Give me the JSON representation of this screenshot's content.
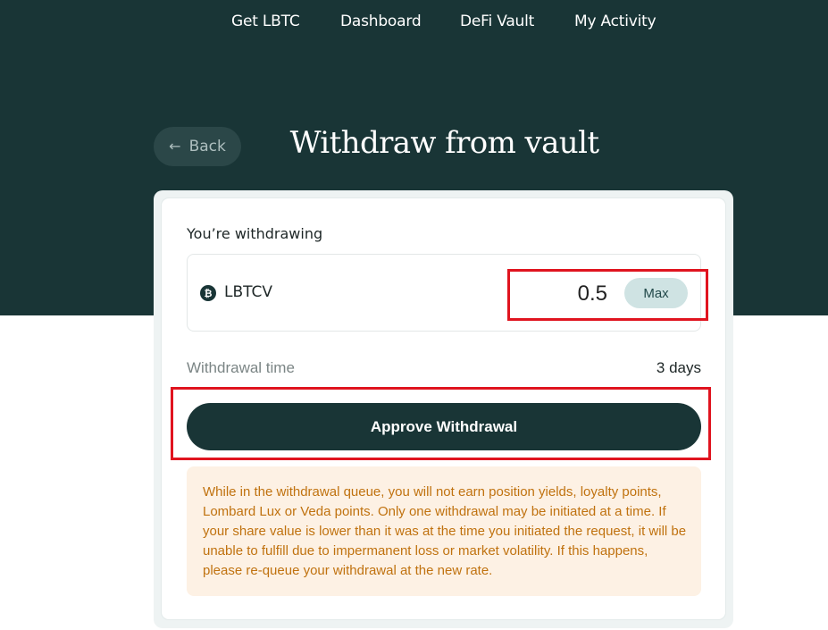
{
  "nav": {
    "items": [
      {
        "label": "Get LBTC"
      },
      {
        "label": "Dashboard"
      },
      {
        "label": "DeFi Vault"
      },
      {
        "label": "My Activity"
      }
    ]
  },
  "header": {
    "back_label": "Back",
    "title": "Withdraw from vault"
  },
  "form": {
    "withdrawing_label": "You’re withdrawing",
    "token": {
      "symbol": "LBTCV",
      "icon": "bitcoin-icon"
    },
    "amount_value": "0.5",
    "max_label": "Max",
    "withdrawal_time_label": "Withdrawal time",
    "withdrawal_time_value": "3 days",
    "approve_label": "Approve Withdrawal",
    "notice": "While in the withdrawal queue, you will not earn position yields, loyalty points, Lombard Lux or Veda points. Only one withdrawal may be initiated at a time. If your share value is lower than it was at the time you initiated the request, it will be unable to fulfill due to impermanent loss or market volatility. If this happens, please re-queue your withdrawal at the new rate."
  },
  "colors": {
    "brand_dark": "#193536",
    "highlight": "#e0141f",
    "notice_bg": "#fdf1e4",
    "notice_text": "#c0720f",
    "max_bg": "#cfe3e3"
  }
}
